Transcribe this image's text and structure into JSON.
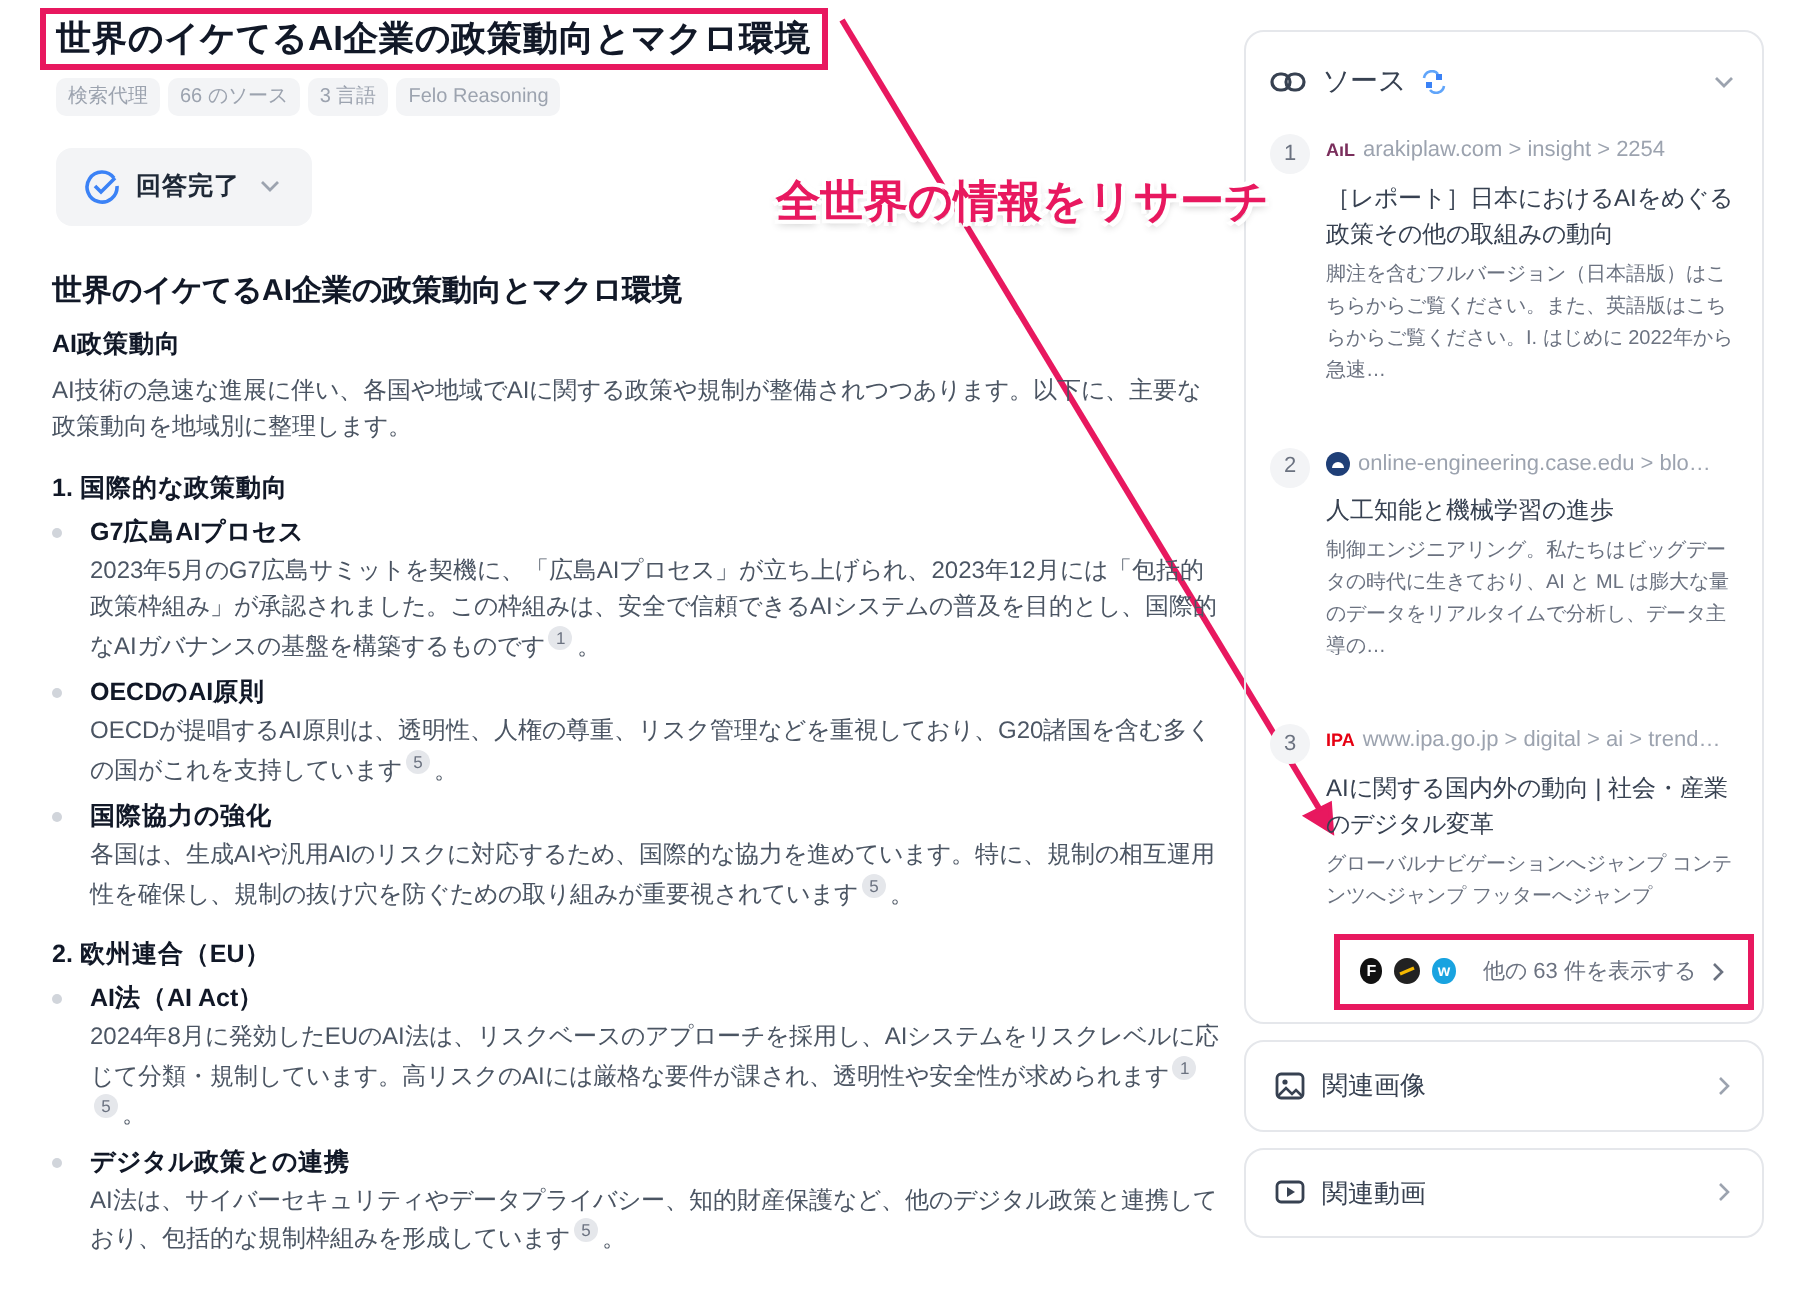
{
  "title": "世界のイケてるAI企業の政策動向とマクロ環境",
  "tags": [
    "検索代理",
    "66 のソース",
    "3 言語",
    "Felo Reasoning"
  ],
  "status_button": {
    "label": "回答完了",
    "expanded": false
  },
  "answer": [
    {
      "kind": "heading",
      "text": "世界のイケてるAI企業の政策動向とマクロ環境"
    },
    {
      "kind": "subheading",
      "text": "AI政策動向"
    },
    {
      "kind": "paragraph",
      "text": "AI技術の急速な進展に伴い、各国や地域でAIに関する政策や規制が整備されつつあります。以下に、主要な政策動向を地域別に整理します。"
    },
    {
      "kind": "section",
      "text": "1. 国際的な政策動向"
    },
    {
      "kind": "bullet",
      "title": "G7広島AIプロセス",
      "text": "2023年5月のG7広島サミットを契機に、「広島AIプロセス」が立ち上げられ、2023年12月には「包括的政策枠組み」が承認されました。この枠組みは、安全で信頼できるAIシステムの普及を目的とし、国際的なAIガバナンスの基盤を構築するものです",
      "citations": [
        "1"
      ],
      "end": "。"
    },
    {
      "kind": "bullet",
      "title": "OECDのAI原則",
      "text": "OECDが提唱するAI原則は、透明性、人権の尊重、リスク管理などを重視しており、G20諸国を含む多くの国がこれを支持しています",
      "citations": [
        "5"
      ],
      "end": "。"
    },
    {
      "kind": "bullet",
      "title": "国際協力の強化",
      "text": "各国は、生成AIや汎用AIのリスクに対応するため、国際的な協力を進めています。特に、規制の相互運用性を確保し、規制の抜け穴を防ぐための取り組みが重要視されています",
      "citations": [
        "5"
      ],
      "end": "。"
    },
    {
      "kind": "section",
      "text": "2. 欧州連合（EU）"
    },
    {
      "kind": "bullet",
      "title": "AI法（AI Act）",
      "text": "2024年8月に発効したEUのAI法は、リスクベースのアプローチを採用し、AIシステムをリスクレベルに応じて分類・規制しています。高リスクのAIには厳格な要件が課され、透明性や安全性が求められます",
      "citations": [
        "1",
        "5"
      ],
      "end": "。"
    },
    {
      "kind": "bullet",
      "title": "デジタル政策との連携",
      "text": "AI法は、サイバーセキュリティやデータプライバシー、知的財産保護など、他のデジタル政策と連携しており、包括的な規制枠組みを形成しています",
      "citations": [
        "5"
      ],
      "end": "。"
    }
  ],
  "sources": {
    "title": "ソース",
    "expanded": true,
    "items": [
      {
        "number": "1",
        "logo": {
          "kind": "wordmark",
          "text": "AıL",
          "color": "#7a2e5c"
        },
        "domain": "arakiplaw.com > insight > 2254",
        "title": "［レポート］日本におけるAIをめぐる政策その他の取組みの動向",
        "snippet": "脚注を含むフルバージョン（日本語版）はこちらからご覧ください。また、英語版はこちらからご覧ください。I. はじめに 2022年から急速…"
      },
      {
        "number": "2",
        "logo": {
          "kind": "badge",
          "color": "#1f3f77"
        },
        "domain": "online-engineering.case.edu > blo…",
        "title": "人工知能と機械学習の進歩",
        "snippet": "制御エンジニアリング。私たちはビッグデータの時代に生きており、AI と ML は膨大な量のデータをリアルタイムで分析し、データ主導の…"
      },
      {
        "number": "3",
        "logo": {
          "kind": "wordmark",
          "text": "IPA",
          "color": "#e60012"
        },
        "domain": "www.ipa.go.jp > digital > ai > trend…",
        "title": "AIに関する国内外の動向 | 社会・産業のデジタル変革",
        "snippet": "グローバルナビゲーションへジャンプ コンテンツへジャンプ フッターへジャンプ"
      }
    ],
    "more_logos": [
      {
        "kind": "letter",
        "text": "F",
        "color": "#111111"
      },
      {
        "kind": "swoosh",
        "color": "#222222"
      },
      {
        "kind": "letter",
        "text": "w",
        "color": "#19a3e0"
      }
    ],
    "more_label": "他の 63 件を表示する"
  },
  "panels": [
    {
      "kind": "image",
      "label": "関連画像"
    },
    {
      "kind": "video",
      "label": "関連動画"
    }
  ],
  "annotation": {
    "callout": "全世界の情報をリサーチ"
  }
}
